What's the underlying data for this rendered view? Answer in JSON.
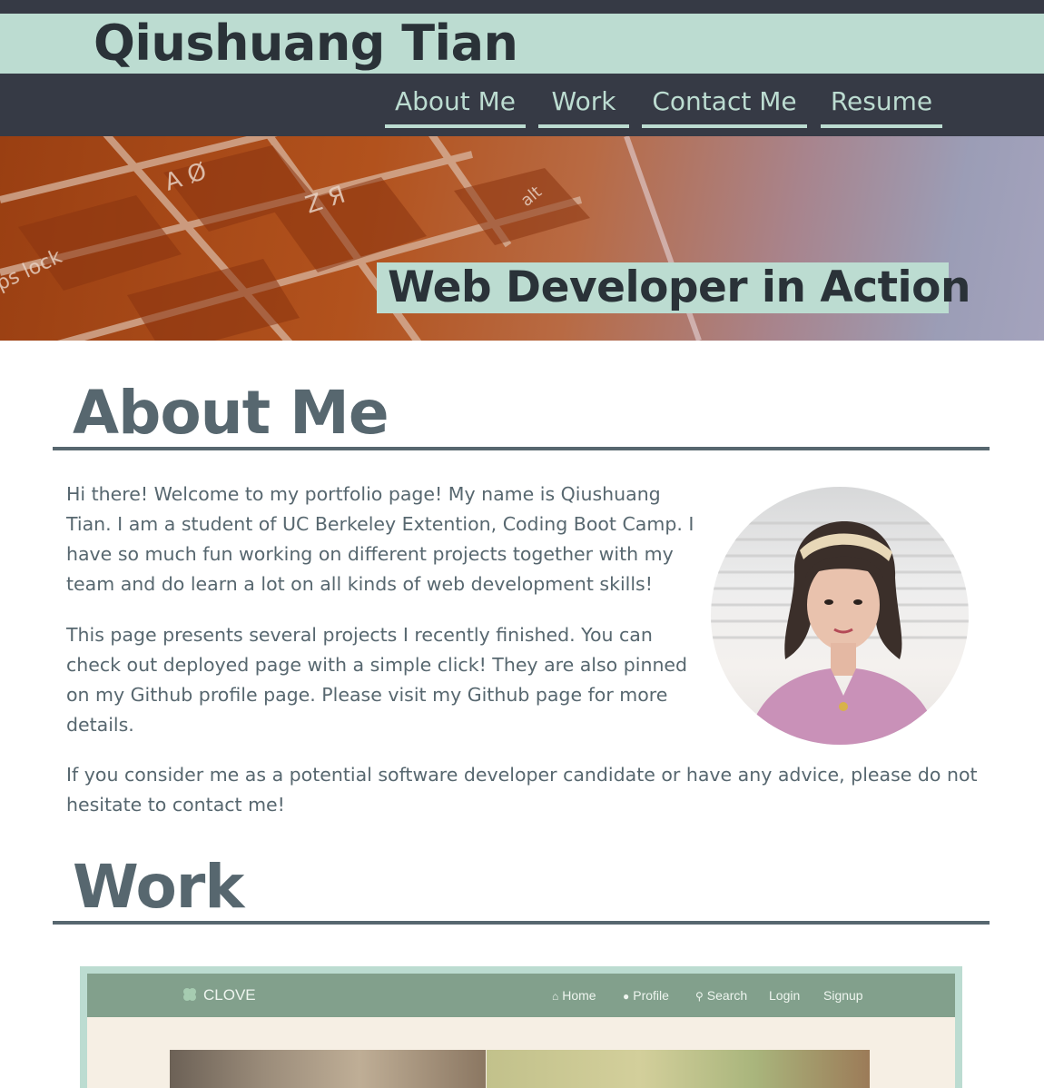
{
  "header": {
    "name": "Qiushuang Tian",
    "nav": [
      {
        "label": "About Me"
      },
      {
        "label": "Work"
      },
      {
        "label": "Contact Me"
      },
      {
        "label": "Resume"
      }
    ]
  },
  "hero": {
    "tagline": "Web Developer in Action"
  },
  "about": {
    "title": "About Me",
    "paragraphs": [
      "Hi there! Welcome to my portfolio page! My name is Qiushuang Tian. I am a student of UC Berkeley Extention, Coding Boot Camp. I have so much fun working on different projects together with my team and do learn a lot on all kinds of web development skills!",
      "This page presents several projects I recently finished. You can check out deployed page with a simple click! They are also pinned on my Github profile page. Please visit my Github page for more details.",
      "If you consider me as a potential software developer candidate or have any advice, please do not hesitate to contact me!"
    ]
  },
  "work": {
    "title": "Work",
    "project_preview": {
      "logo": "CLOVE",
      "logo_icon": "clover-icon",
      "nav": [
        {
          "label": "Home",
          "icon": "home-icon"
        },
        {
          "label": "Profile",
          "icon": "user-icon"
        },
        {
          "label": "Search",
          "icon": "search-icon"
        },
        {
          "label": "Login"
        },
        {
          "label": "Signup"
        }
      ]
    }
  },
  "colors": {
    "dark": "#363a45",
    "accent": "#bcdcd1",
    "text": "#57676f"
  }
}
